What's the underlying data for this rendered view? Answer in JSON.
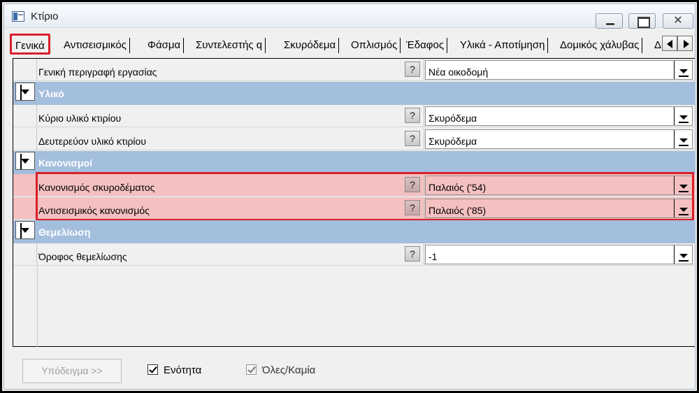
{
  "window": {
    "title": "Κτίριο",
    "controls": {
      "minimize": "▭",
      "maximize": "◫",
      "close": "✕"
    }
  },
  "tabs": [
    {
      "label": "Γενικά",
      "active": true
    },
    {
      "label": "Αντισεισμικός"
    },
    {
      "label": "Φάσμα"
    },
    {
      "label": "Συντελεστής q"
    },
    {
      "label": "Σκυρόδεμα"
    },
    {
      "label": "Οπλισμός"
    },
    {
      "label": "Έδαφος"
    },
    {
      "label": "Υλικά - Αποτίμηση"
    },
    {
      "label": "Δομικός χάλυβας"
    },
    {
      "label": "Δ"
    }
  ],
  "grid": {
    "help_glyph": "?",
    "rows": [
      {
        "label": "Γενική περιγραφή εργασίας",
        "value": "Νέα οικοδομή"
      }
    ],
    "categories": [
      {
        "name": "Υλικό",
        "rows": [
          {
            "label": "Κύριο υλικό κτιρίου",
            "value": "Σκυρόδεμα"
          },
          {
            "label": "Δευτερεύον υλικό κτιρίου",
            "value": "Σκυρόδεμα"
          }
        ]
      },
      {
        "name": "Κανονισμοί",
        "rows": [
          {
            "label": "Κανονισμός σκυροδέματος",
            "value": "Παλαιός ('54)"
          },
          {
            "label": "Αντισεισμικός κανονισμός",
            "value": "Παλαιός ('85)"
          }
        ]
      },
      {
        "name": "Θεμελίωση",
        "rows": [
          {
            "label": "Όροφος θεμελίωσης",
            "value": "-1"
          }
        ]
      }
    ]
  },
  "footer": {
    "sample_button": "Υπόδειγμα >>",
    "unit_checkbox": {
      "label": "Ενότητα",
      "checked": true
    },
    "all_none_checkbox": {
      "label": "Όλες/Καμία",
      "checked": true
    }
  },
  "colors": {
    "category_header": "#a4bedd",
    "highlight_fill": "#f4c0c0",
    "highlight_border": "#d8202a"
  }
}
